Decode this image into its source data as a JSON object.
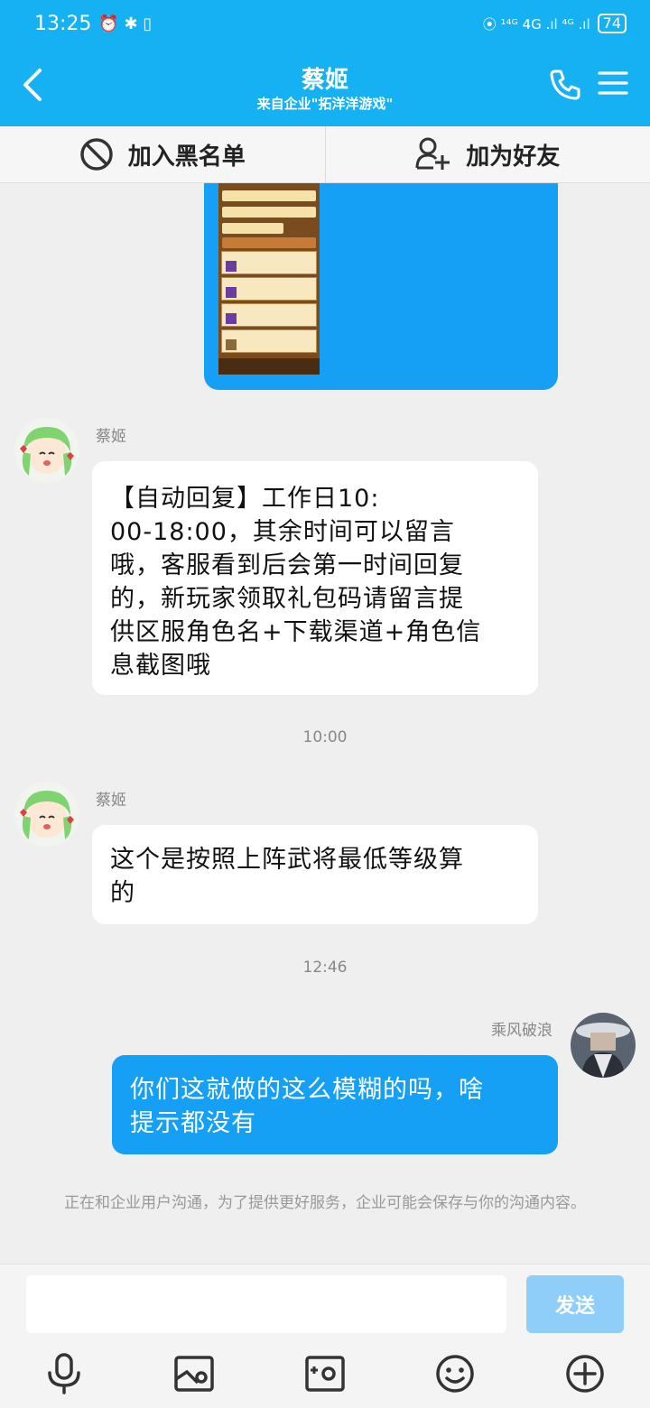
{
  "status_bar": {
    "time": "13:25",
    "left_icons": "⏰ ✱ ▯",
    "network": "⦿ ¹⁴ᴳ 4G .ıl ⁴ᴳ .ıl",
    "battery": "74"
  },
  "header": {
    "title": "蔡姬",
    "subtitle": "来自企业\"拓洋洋游戏\""
  },
  "actions": {
    "blacklist_label": "加入黑名单",
    "add_friend_label": "加为好友"
  },
  "messages": [
    {
      "sender": "蔡姬",
      "text": "【自动回复】工作日10:\n00-18:00，其余时间可以留言\n哦，客服看到后会第一时间回复\n的，新玩家领取礼包码请留言提\n供区服角色名+下载渠道+角色信\n息截图哦"
    },
    {
      "time": "10:00"
    },
    {
      "sender": "蔡姬",
      "text": "这个是按照上阵武将最低等级算\n的"
    },
    {
      "time": "12:46"
    },
    {
      "sender": "乘风破浪",
      "text": "你们这就做的这么模糊的吗，啥\n提示都没有"
    }
  ],
  "notice": "正在和企业用户沟通，为了提供更好服务，企业可能会保存与你的沟通内容。",
  "composer": {
    "input_value": "",
    "send_label": "发送"
  },
  "toolbar_icons": [
    "microphone-icon",
    "image-icon",
    "camera-icon",
    "emoji-icon",
    "plus-icon"
  ],
  "colors": {
    "header": "#15b1f2",
    "my_bubble": "#16a0f5",
    "send_disabled": "#8ecef8"
  }
}
